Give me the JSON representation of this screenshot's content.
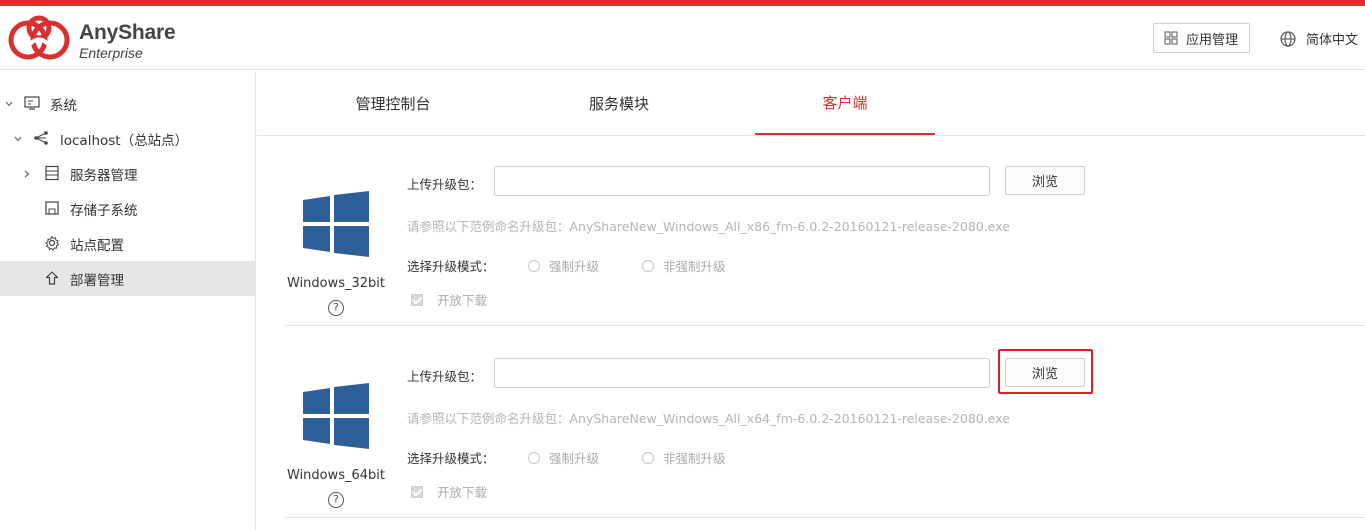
{
  "brand": {
    "name": "AnyShare",
    "edition": "Enterprise",
    "accent_color": "#d8312f"
  },
  "header": {
    "app_manage_label": "应用管理",
    "app_manage_icon": "grid-icon",
    "language_label": "简体中文",
    "language_icon": "globe-icon"
  },
  "sidebar": {
    "items": [
      {
        "label": "系统",
        "icon": "server-panel-icon",
        "expander": "chevron-down-icon"
      },
      {
        "label": "localhost（总站点）",
        "icon": "share-nodes-icon",
        "expander": "chevron-down-icon"
      },
      {
        "label": "服务器管理",
        "icon": "server-list-icon",
        "expander": "chevron-right-icon"
      },
      {
        "label": "存储子系统",
        "icon": "storage-icon"
      },
      {
        "label": "站点配置",
        "icon": "gear-icon"
      },
      {
        "label": "部署管理",
        "icon": "upload-arrow-icon",
        "selected": true
      }
    ]
  },
  "tabs": [
    {
      "label": "管理控制台"
    },
    {
      "label": "服务模块"
    },
    {
      "label": "客户端",
      "active": true
    }
  ],
  "clients": [
    {
      "os_name": "Windows_32bit",
      "os_icon": "windows-logo-icon",
      "help": "?",
      "upload_label": "上传升级包：",
      "upload_value": "",
      "browse_label": "浏览",
      "hint": "请参照以下范例命名升级包：AnyShareNew_Windows_All_x86_fm-6.0.2-20160121-release-2080.exe",
      "mode_label": "选择升级模式：",
      "mode_options": [
        "强制升级",
        "非强制升级"
      ],
      "open_download_label": "开放下载",
      "open_download_checked": true
    },
    {
      "os_name": "Windows_64bit",
      "os_icon": "windows-logo-icon",
      "help": "?",
      "upload_label": "上传升级包：",
      "upload_value": "",
      "browse_label": "浏览",
      "hint": "请参照以下范例命名升级包：AnyShareNew_Windows_All_x64_fm-6.0.2-20160121-release-2080.exe",
      "mode_label": "选择升级模式：",
      "mode_options": [
        "强制升级",
        "非强制升级"
      ],
      "open_download_label": "开放下载",
      "open_download_checked": true
    }
  ]
}
